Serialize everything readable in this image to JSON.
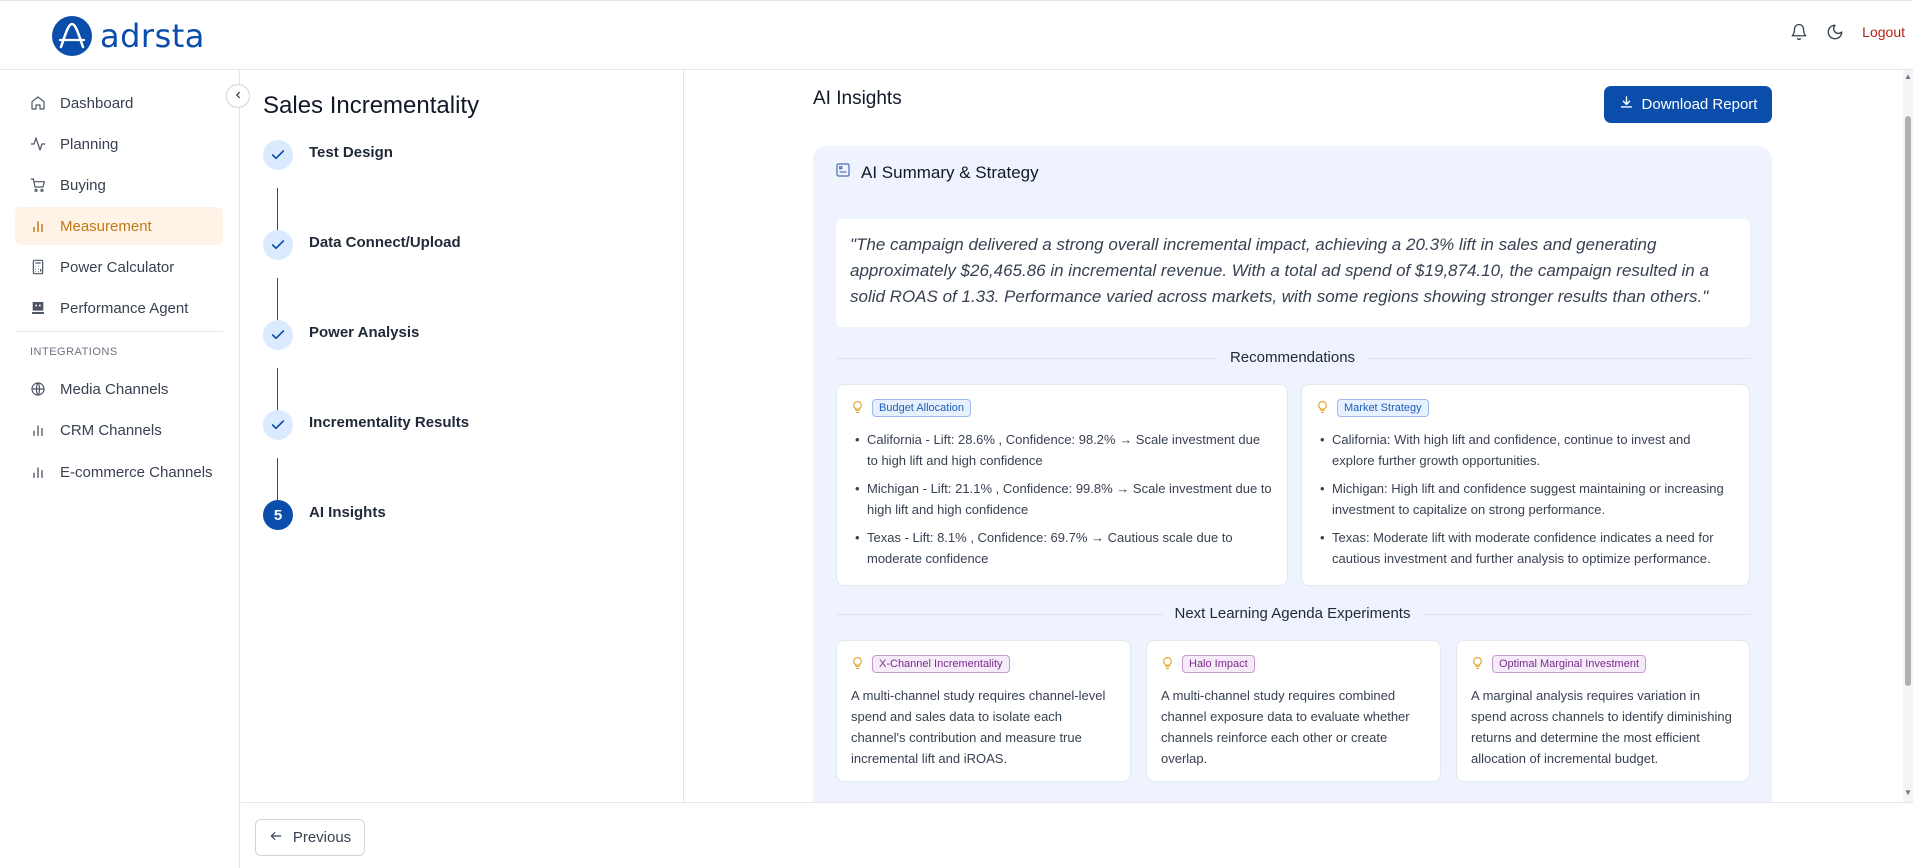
{
  "header": {
    "logo_text": "adrsta",
    "logout_label": "Logout",
    "icons": [
      "bell-icon",
      "moon-icon"
    ]
  },
  "sidebar": {
    "items": [
      {
        "label": "Dashboard",
        "icon": "home-icon"
      },
      {
        "label": "Planning",
        "icon": "activity-icon"
      },
      {
        "label": "Buying",
        "icon": "cart-icon"
      },
      {
        "label": "Measurement",
        "icon": "bar-chart-icon",
        "active": true
      },
      {
        "label": "Power Calculator",
        "icon": "calculator-icon"
      },
      {
        "label": "Performance Agent",
        "icon": "agent-icon"
      }
    ],
    "section_label": "INTEGRATIONS",
    "integrations": [
      {
        "label": "Media Channels",
        "icon": "globe-icon"
      },
      {
        "label": "CRM Channels",
        "icon": "bar-chart-icon"
      },
      {
        "label": "E-commerce Channels",
        "icon": "bar-chart-icon"
      }
    ],
    "accent_color": "#c07a14"
  },
  "stepper": {
    "title": "Sales Incrementality",
    "steps": [
      {
        "label": "Test Design",
        "status": "done"
      },
      {
        "label": "Data Connect/Upload",
        "status": "done"
      },
      {
        "label": "Power Analysis",
        "status": "done"
      },
      {
        "label": "Incrementality Results",
        "status": "done"
      },
      {
        "label": "AI Insights",
        "status": "current",
        "number": "5"
      }
    ]
  },
  "main": {
    "title": "AI Insights",
    "download_label": "Download Report",
    "panel_title": "AI Summary & Strategy",
    "summary": "\"The campaign delivered a strong overall incremental impact, achieving a 20.3% lift in sales and generating approximately $26,465.86 in incremental revenue. With a total ad spend of $19,874.10, the campaign resulted in a solid ROAS of 1.33. Performance varied across markets, with some regions showing stronger results than others.\"",
    "recommendations_title": "Recommendations",
    "recommendations": [
      {
        "tag": "Budget Allocation",
        "items": [
          "California - Lift: 28.6% , Confidence: 98.2% → Scale investment due to high lift and high confidence",
          "Michigan - Lift: 21.1% , Confidence: 99.8% → Scale investment due to high lift and high confidence",
          "Texas - Lift: 8.1% , Confidence: 69.7% → Cautious scale due to moderate confidence"
        ]
      },
      {
        "tag": "Market Strategy",
        "items": [
          "California: With high lift and confidence, continue to invest and explore further growth opportunities.",
          "Michigan: High lift and confidence suggest maintaining or increasing investment to capitalize on strong performance.",
          "Texas: Moderate lift with moderate confidence indicates a need for cautious investment and further analysis to optimize performance."
        ]
      }
    ],
    "agenda_title": "Next Learning Agenda Experiments",
    "experiments": [
      {
        "tag": "X-Channel Incrementality",
        "text": "A multi-channel study requires channel-level spend and sales data to isolate each channel's contribution and measure true incremental lift and iROAS."
      },
      {
        "tag": "Halo Impact",
        "text": "A multi-channel study requires combined channel exposure data to evaluate whether channels reinforce each other or create overlap."
      },
      {
        "tag": "Optimal Marginal Investment",
        "text": "A marginal analysis requires variation in spend across channels to identify diminishing returns and determine the most efficient allocation of incremental budget."
      }
    ]
  },
  "footer": {
    "previous_label": "Previous"
  },
  "colors": {
    "primary": "#0b4dab",
    "logout": "#b42318",
    "panel_bg": "#eef3fd"
  }
}
